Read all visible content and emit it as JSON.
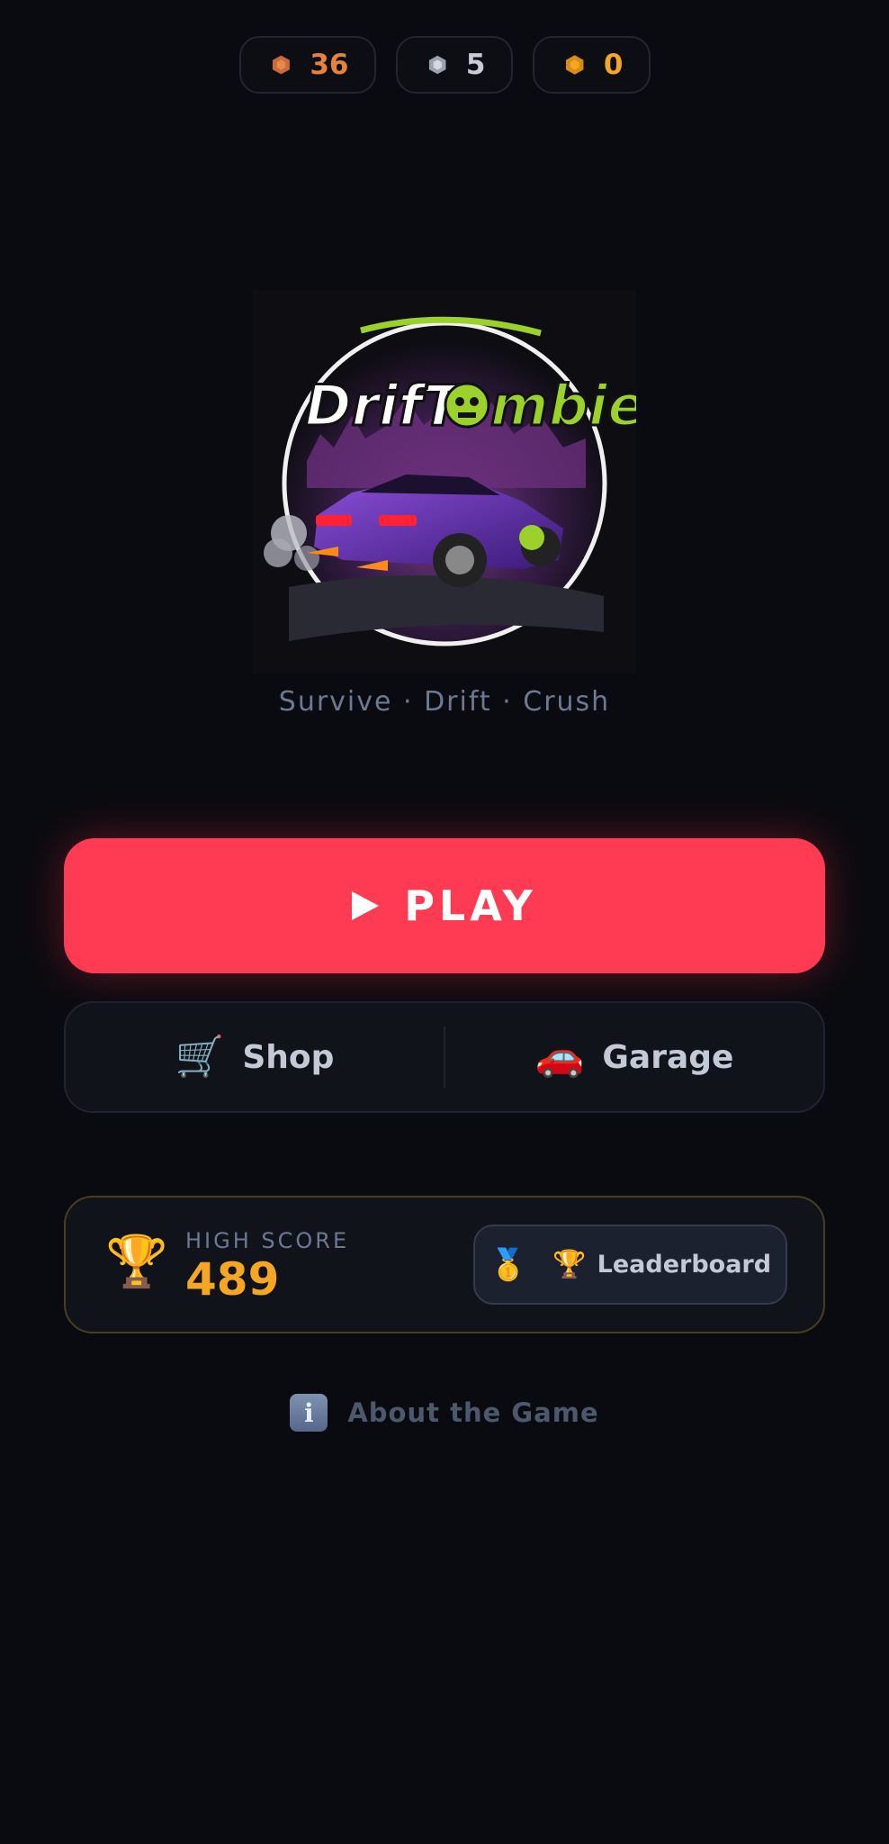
{
  "currencies": [
    {
      "name": "bronze",
      "value": "36",
      "color": "#e8823a"
    },
    {
      "name": "silver",
      "value": "5",
      "color": "#c8ccd4"
    },
    {
      "name": "gold",
      "value": "0",
      "color": "#f5a623"
    }
  ],
  "logo": {
    "text": "DrifTombie"
  },
  "tagline": "Survive · Drift · Crush",
  "play": {
    "label": "PLAY",
    "color": "#ff3b53"
  },
  "nav": {
    "shop": {
      "label": "Shop",
      "icon": "🛒"
    },
    "garage": {
      "label": "Garage",
      "icon": "🚗"
    }
  },
  "high_score": {
    "label": "HIGH SCORE",
    "value": "489",
    "icon": "🏆",
    "leaderboard": {
      "label": "Leaderboard",
      "medal_icon": "🥇",
      "cup_icon": "🏆"
    }
  },
  "about": {
    "label": "About the Game",
    "icon_text": "i"
  }
}
